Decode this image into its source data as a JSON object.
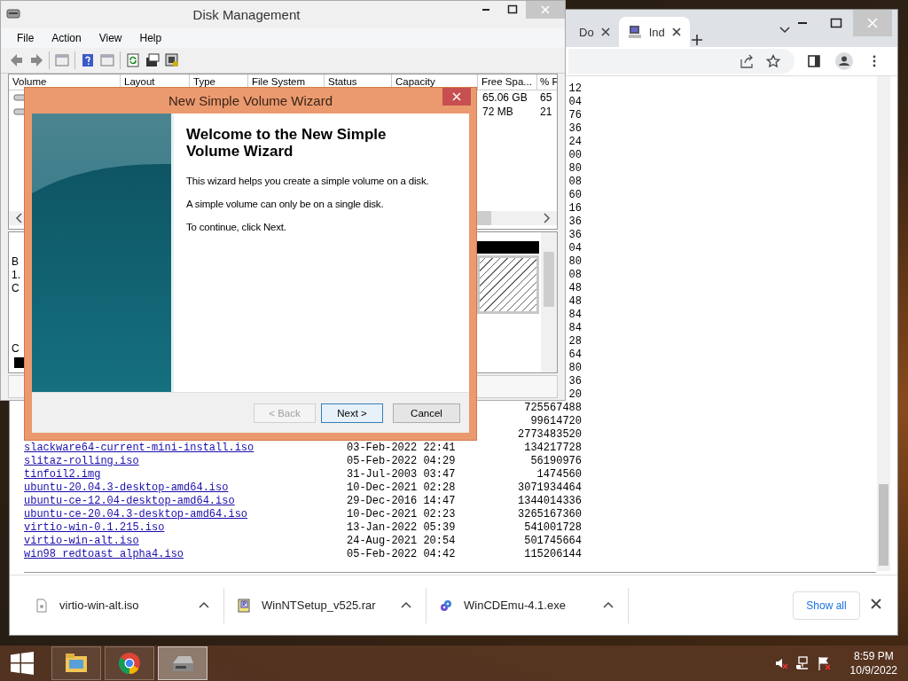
{
  "browser": {
    "tabs": [
      {
        "title": "Do",
        "selected": false
      },
      {
        "title": "Ind",
        "selected": true
      }
    ],
    "listing": [
      {
        "size": "12"
      },
      {
        "size": "04"
      },
      {
        "size": "76"
      },
      {
        "size": "36"
      },
      {
        "size": "24"
      },
      {
        "size": "00"
      },
      {
        "size": "80"
      },
      {
        "size": "08"
      },
      {
        "size": "60"
      },
      {
        "size": "16"
      },
      {
        "size": "36"
      },
      {
        "size": "36"
      },
      {
        "size": "04"
      },
      {
        "size": "80"
      },
      {
        "size": "08"
      },
      {
        "size": "48"
      },
      {
        "size": "48"
      },
      {
        "size": "84"
      },
      {
        "size": "84"
      },
      {
        "size": "28"
      },
      {
        "size": "64"
      },
      {
        "size": "80"
      },
      {
        "size": "36"
      },
      {
        "size": "20"
      },
      {
        "size": "725567488"
      },
      {
        "size": "99614720"
      },
      {
        "size": "2773483520"
      },
      {
        "name": "slackware64-current-mini-install.iso",
        "date": "03-Feb-2022 22:41",
        "size": "134217728"
      },
      {
        "name": "slitaz-rolling.iso",
        "date": "05-Feb-2022 04:29",
        "size": "56190976"
      },
      {
        "name": "tinfoil2.img",
        "date": "31-Jul-2003 03:47",
        "size": "1474560"
      },
      {
        "name": "ubuntu-20.04.3-desktop-amd64.iso",
        "date": "10-Dec-2021 02:28",
        "size": "3071934464"
      },
      {
        "name": "ubuntu-ce-12.04-desktop-amd64.iso",
        "date": "29-Dec-2016 14:47",
        "size": "1344014336"
      },
      {
        "name": "ubuntu-ce-20.04.3-desktop-amd64.iso",
        "date": "10-Dec-2021 02:23",
        "size": "3265167360"
      },
      {
        "name": "virtio-win-0.1.215.iso",
        "date": "13-Jan-2022 05:39",
        "size": "541001728"
      },
      {
        "name": "virtio-win-alt.iso",
        "date": "24-Aug-2021 20:54",
        "size": "501745664"
      },
      {
        "name": "win98_redtoast_alpha4.iso",
        "date": "05-Feb-2022 04:42",
        "size": "115206144"
      }
    ],
    "downloads": [
      {
        "filename": "virtio-win-alt.iso",
        "kind": "file"
      },
      {
        "filename": "WinNTSetup_v525.rar",
        "kind": "archive"
      },
      {
        "filename": "WinCDEmu-4.1.exe",
        "kind": "installer"
      }
    ],
    "show_all": "Show all"
  },
  "disk_management": {
    "title": "Disk Management",
    "menu": [
      "File",
      "Action",
      "View",
      "Help"
    ],
    "columns": [
      "Volume",
      "Layout",
      "Type",
      "File System",
      "Status",
      "Capacity",
      "Free Spa...",
      "% F"
    ],
    "rows": [
      {
        "free_space": "65.06 GB",
        "percent_free": "65"
      },
      {
        "free_space": "72 MB",
        "percent_free": "21"
      }
    ],
    "disk_0_labels": [
      "B",
      "1.",
      "C"
    ],
    "disk_1_labels": [
      "C"
    ]
  },
  "wizard": {
    "title": "New Simple Volume Wizard",
    "heading": "Welcome to the New Simple Volume Wizard",
    "paragraphs": [
      "This wizard helps you create a simple volume on a disk.",
      "A simple volume can only be on a single disk.",
      "To continue, click Next."
    ],
    "buttons": [
      {
        "label": "< Back",
        "disabled": true,
        "focused": false
      },
      {
        "label": "Next >",
        "disabled": false,
        "focused": true
      },
      {
        "label": "Cancel",
        "disabled": false,
        "focused": false
      }
    ]
  },
  "taskbar": {
    "apps": [
      {
        "kind": "explorer",
        "selected": false
      },
      {
        "kind": "chrome",
        "selected": false
      },
      {
        "kind": "disk",
        "selected": true
      }
    ],
    "time": "8:59 PM",
    "date": "10/9/2022"
  }
}
